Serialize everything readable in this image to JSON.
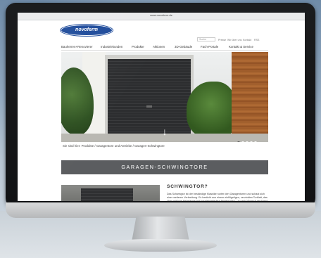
{
  "browser": {
    "address": "www.novoferm.de"
  },
  "header": {
    "logo_text": "novoferm",
    "search_placeholder": "Suche",
    "utility_links": [
      "Presse",
      "Wir über uns",
      "Kontakt",
      "RSS"
    ]
  },
  "nav": {
    "items": [
      "Bauherren+Renovierer",
      "Industriekunden",
      "Produkte",
      "Aktionen",
      "3D-Gebäude",
      "Fach-Portale",
      "Kontakt & Service"
    ]
  },
  "hero": {
    "slides_total": 5,
    "active_slide": 1
  },
  "breadcrumb": "Sie sind hier: Produkte / Garagentore und Antriebe / Garagen-Schwingtore",
  "section": {
    "title": "GARAGEN-SCHWINGTORE"
  },
  "content": {
    "heading": "SCHWINGTOR?",
    "paragraph": "Das Schwingtor ist der beständige Klassiker unter den Garagentoren und schaut sich einer weiteren Verbreitung. Es besticht aus einem einflügeligen, verzinkten Torblatt, das über seitliche Hebelarme mit Ausgleichsfedern bewegt wird – je nach Wunsch per Hand oder elektrischen Antrieb. Dabei"
  },
  "colors": {
    "brand_blue": "#1d4a9a",
    "section_bar": "#5b5d60",
    "bezel": "#151618"
  }
}
